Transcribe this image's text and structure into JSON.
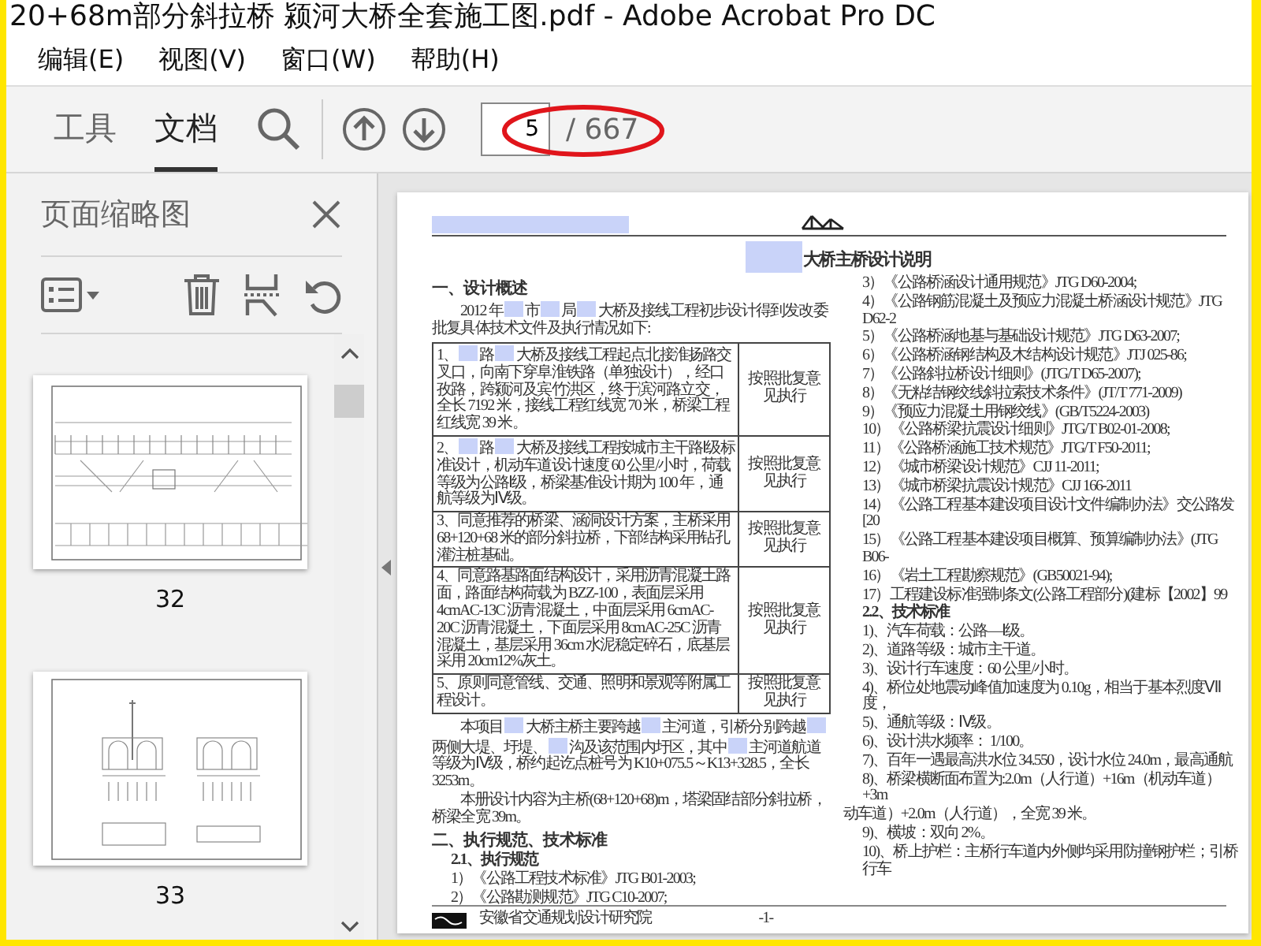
{
  "window": {
    "title": "20+68m部分斜拉桥 颍河大桥全套施工图.pdf - Adobe Acrobat Pro DC"
  },
  "menu": [
    "编辑(E)",
    "视图(V)",
    "窗口(W)",
    "帮助(H)"
  ],
  "toolbar": {
    "tabs": [
      {
        "label": "工具",
        "selected": false
      },
      {
        "label": "文档",
        "selected": true
      }
    ],
    "page_number": "5",
    "page_total": "/ 667"
  },
  "thumbnails_panel": {
    "title": "页面缩略图",
    "pages": [
      {
        "label": "32",
        "kind": "elevation"
      },
      {
        "label": "33",
        "kind": "pier"
      }
    ]
  },
  "document": {
    "header": [
      {
        "kind": "redaction"
      }
    ],
    "title": [
      {
        "kind": "redaction"
      },
      {
        "kind": "text",
        "text": "大桥主桥设计说明"
      }
    ],
    "left": [
      {
        "kind": "heading",
        "segments": [
          {
            "kind": "text",
            "text": "一、设计概述"
          }
        ]
      },
      {
        "kind": "paragraph",
        "segments": [
          {
            "kind": "text",
            "text": "2012 年"
          },
          {
            "kind": "redaction"
          },
          {
            "kind": "text",
            "text": "市"
          },
          {
            "kind": "redaction"
          },
          {
            "kind": "text",
            "text": "局"
          },
          {
            "kind": "redaction"
          },
          {
            "kind": "text",
            "text": "大桥及接线工程初步设计得到发改委批复具体技术文件及执行情况如下:"
          }
        ]
      },
      {
        "kind": "table",
        "rows": [
          {
            "segments": [
              {
                "kind": "text",
                "text": "1、"
              },
              {
                "kind": "redaction"
              },
              {
                "kind": "text",
                "text": "路"
              },
              {
                "kind": "redaction"
              },
              {
                "kind": "text",
                "text": "大桥及接线工程起点北接淮扬路交叉口，向南下穿阜淮铁路（单独设计），经口孜路，跨颍河及宾竹洪区，终于滨河路立交，全长 7192 米，接线工程红线宽 70 米，桥梁工程红线宽 39 米。"
              }
            ],
            "note": "按照批复意见执行"
          },
          {
            "segments": [
              {
                "kind": "text",
                "text": "2、"
              },
              {
                "kind": "redaction"
              },
              {
                "kind": "text",
                "text": "路"
              },
              {
                "kind": "redaction"
              },
              {
                "kind": "text",
                "text": "大桥及接线工程按城市主干路Ⅰ级标准设计，机动车道设计速度 60 公里/小时，荷载等级为公路Ⅰ级，桥梁基准设计期为 100 年，通航等级为Ⅳ级。"
              }
            ],
            "note": "按照批复意见执行"
          },
          {
            "segments": [
              {
                "kind": "text",
                "text": "3、同意推荐的桥梁、涵洞设计方案，主桥采用 68+120+68 米的部分斜拉桥，下部结构采用钻孔灌注桩基础。"
              }
            ],
            "note": "按照批复意见执行"
          },
          {
            "segments": [
              {
                "kind": "text",
                "text": "4、同意路基路面结构设计，采用沥青混凝土路面，路面结构荷载为 BZZ-100，表面层采用 4cmAC-13C 沥青混凝土，中面层采用 6cmAC-20C 沥青混凝土，下面层采用 8cmAC-25C 沥青混凝土，基层采用 36cm 水泥稳定碎石，底基层采用 20cm12%灰土。"
              }
            ],
            "note": "按照批复意见执行"
          },
          {
            "segments": [
              {
                "kind": "text",
                "text": "5、原则同意管线、交通、照明和景观等附属工程设计。"
              }
            ],
            "note": "按照批复意见执行"
          }
        ]
      },
      {
        "kind": "paragraph",
        "segments": [
          {
            "kind": "text",
            "text": "本项目"
          },
          {
            "kind": "redaction"
          },
          {
            "kind": "text",
            "text": "大桥主桥主要跨越"
          },
          {
            "kind": "redaction"
          },
          {
            "kind": "text",
            "text": "主河道，引桥分别跨越"
          },
          {
            "kind": "redaction"
          },
          {
            "kind": "text",
            "text": "两侧大堤、圩堤、"
          },
          {
            "kind": "redaction"
          },
          {
            "kind": "text",
            "text": "沟及该范围内圩区，其中"
          },
          {
            "kind": "redaction"
          },
          {
            "kind": "text",
            "text": "主河道航道等级为Ⅳ级，桥约起讫点桩号为 K10+075.5～K13+328.5，全长 3253m。"
          }
        ]
      },
      {
        "kind": "paragraph",
        "segments": [
          {
            "kind": "text",
            "text": "本册设计内容为主桥(68+120+68)m，塔梁固结部分斜拉桥，桥梁全宽 39m。"
          }
        ]
      },
      {
        "kind": "heading",
        "segments": [
          {
            "kind": "text",
            "text": "二、执行规范、技术标准"
          }
        ]
      },
      {
        "kind": "subheading",
        "segments": [
          {
            "kind": "text",
            "text": "2.1、执行规范"
          }
        ]
      },
      {
        "kind": "item",
        "segments": [
          {
            "kind": "text",
            "text": "1）《公路工程技术标准》JTG B01-2003;"
          }
        ]
      },
      {
        "kind": "item",
        "segments": [
          {
            "kind": "text",
            "text": "2）《公路勘测规范》JTG C10-2007;"
          }
        ]
      }
    ],
    "right": [
      {
        "kind": "item",
        "segments": [
          {
            "kind": "text",
            "text": "3）《公路桥涵设计通用规范》JTG D60-2004;"
          }
        ]
      },
      {
        "kind": "item",
        "segments": [
          {
            "kind": "text",
            "text": "4）《公路钢筋混凝土及预应力混凝土桥涵设计规范》JTG D62-2"
          }
        ]
      },
      {
        "kind": "item",
        "segments": [
          {
            "kind": "text",
            "text": "5）《公路桥涵地基与基础设计规范》JTG D63-2007;"
          }
        ]
      },
      {
        "kind": "item",
        "segments": [
          {
            "kind": "text",
            "text": "6）《公路桥涵钢结构及木结构设计规范》JTJ 025-86;"
          }
        ]
      },
      {
        "kind": "item",
        "segments": [
          {
            "kind": "text",
            "text": "7）《公路斜拉桥设计细则》(JTG/T D65-2007);"
          }
        ]
      },
      {
        "kind": "item",
        "segments": [
          {
            "kind": "text",
            "text": "8）《无粘结钢绞线斜拉索技术条件》(JT/T 771-2009)"
          }
        ]
      },
      {
        "kind": "item",
        "segments": [
          {
            "kind": "text",
            "text": "9）《预应力混凝土用钢绞线》(GB/T5224-2003)"
          }
        ]
      },
      {
        "kind": "item",
        "segments": [
          {
            "kind": "text",
            "text": "10）《公路桥梁抗震设计细则》JTG/T B02-01-2008;"
          }
        ]
      },
      {
        "kind": "item",
        "segments": [
          {
            "kind": "text",
            "text": "11）《公路桥涵施工技术规范》JTG/T F50-2011;"
          }
        ]
      },
      {
        "kind": "item",
        "segments": [
          {
            "kind": "text",
            "text": "12）《城市桥梁设计规范》CJJ 11-2011;"
          }
        ]
      },
      {
        "kind": "item",
        "segments": [
          {
            "kind": "text",
            "text": "13）《城市桥梁抗震设计规范》CJJ 166-2011"
          }
        ]
      },
      {
        "kind": "item",
        "segments": [
          {
            "kind": "text",
            "text": "14）《公路工程基本建设项目设计文件编制办法》交公路发[20"
          }
        ]
      },
      {
        "kind": "item",
        "segments": [
          {
            "kind": "text",
            "text": "15）《公路工程基本建设项目概算、预算编制办法》(JTG B06-"
          }
        ]
      },
      {
        "kind": "item",
        "segments": [
          {
            "kind": "text",
            "text": "16）《岩土工程勘察规范》(GB50021-94);"
          }
        ]
      },
      {
        "kind": "item",
        "segments": [
          {
            "kind": "text",
            "text": "17）工程建设标准强制条文(公路工程部分)(建标【2002】99"
          }
        ]
      },
      {
        "kind": "subheading",
        "segments": [
          {
            "kind": "text",
            "text": "2.2、技术标准"
          }
        ]
      },
      {
        "kind": "item",
        "segments": [
          {
            "kind": "text",
            "text": "1)、汽车荷载：公路—Ⅰ级。"
          }
        ]
      },
      {
        "kind": "item",
        "segments": [
          {
            "kind": "text",
            "text": "2)、道路等级：城市主干道。"
          }
        ]
      },
      {
        "kind": "item",
        "segments": [
          {
            "kind": "text",
            "text": "3)、设计行车速度：60 公里/小时。"
          }
        ]
      },
      {
        "kind": "item",
        "segments": [
          {
            "kind": "text",
            "text": "4)、桥位处地震动峰值加速度为 0.10g，相当于基本烈度Ⅶ度，"
          }
        ]
      },
      {
        "kind": "item",
        "segments": [
          {
            "kind": "text",
            "text": "5)、通航等级：Ⅳ级。"
          }
        ]
      },
      {
        "kind": "item",
        "segments": [
          {
            "kind": "text",
            "text": "6)、设计洪水频率： 1/100。"
          }
        ]
      },
      {
        "kind": "item",
        "segments": [
          {
            "kind": "text",
            "text": "7)、百年一遇最高洪水位 34.550，设计水位 24.0m，最高通航"
          }
        ]
      },
      {
        "kind": "item",
        "segments": [
          {
            "kind": "text",
            "text": "8)、桥梁横断面布置为:2.0m（人行道）+16m（机动车道）+3m"
          }
        ]
      },
      {
        "kind": "continuation",
        "segments": [
          {
            "kind": "text",
            "text": "动车道）+2.0m（人行道），全宽 39 米。"
          }
        ]
      },
      {
        "kind": "item",
        "segments": [
          {
            "kind": "text",
            "text": "9)、横坡：双向 2%。"
          }
        ]
      },
      {
        "kind": "item",
        "segments": [
          {
            "kind": "text",
            "text": "10)、桥上护栏：主桥行车道内外侧均采用防撞钢护栏；引桥行车"
          }
        ]
      }
    ],
    "footer": {
      "organization": "安徽省交通规划设计研究院",
      "page_label": "-1-"
    }
  }
}
